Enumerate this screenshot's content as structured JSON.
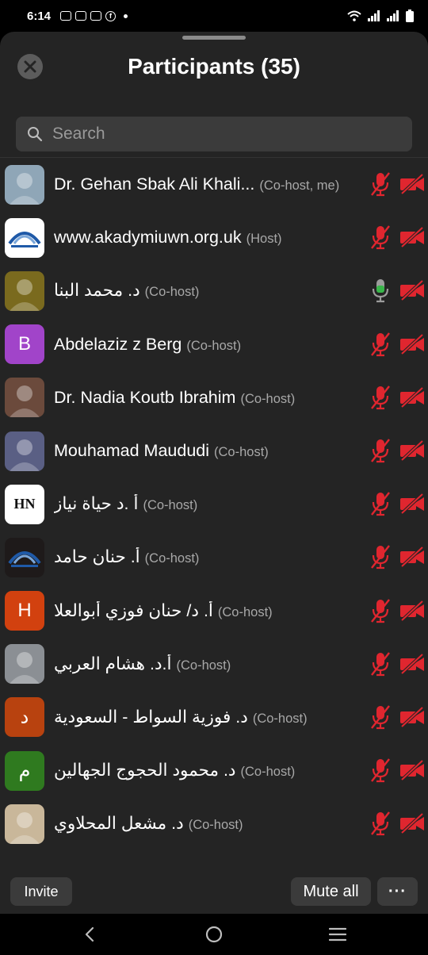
{
  "status_bar": {
    "time": "6:14",
    "notifications": [
      "notif-icon",
      "notif-icon",
      "notif-icon",
      "facebook-icon"
    ],
    "fb_glyph": "f"
  },
  "header": {
    "title": "Participants (35)"
  },
  "search": {
    "placeholder": "Search"
  },
  "colors": {
    "muted": "#e0262f",
    "live_mic": "#39b54a",
    "sheet_bg": "#242424"
  },
  "participants": [
    {
      "name": "Dr. Gehan Sbak Ali Khali...",
      "role": "(Co-host, me)",
      "avatar": {
        "type": "photo",
        "letter": "",
        "bg": "#8fa6b7"
      },
      "mic": "muted",
      "video": "off"
    },
    {
      "name": "www.akadymiuwn.org.uk",
      "role": "(Host)",
      "avatar": {
        "type": "logo",
        "letter": "",
        "bg": "#ffffff"
      },
      "mic": "muted",
      "video": "off"
    },
    {
      "name": "د. محمد البنا",
      "role": "(Co-host)",
      "avatar": {
        "type": "photo",
        "letter": "",
        "bg": "#7a6a1e"
      },
      "mic": "live",
      "video": "off"
    },
    {
      "name": "Abdelaziz z Berg",
      "role": "(Co-host)",
      "avatar": {
        "type": "letter",
        "letter": "B",
        "bg": "#a144c9"
      },
      "mic": "muted",
      "video": "off"
    },
    {
      "name": "Dr. Nadia Koutb Ibrahim",
      "role": "(Co-host)",
      "avatar": {
        "type": "photo",
        "letter": "",
        "bg": "#6b4a3c"
      },
      "mic": "muted",
      "video": "off"
    },
    {
      "name": "Mouhamad Maududi",
      "role": "(Co-host)",
      "avatar": {
        "type": "photo",
        "letter": "",
        "bg": "#5a5f84"
      },
      "mic": "muted",
      "video": "off"
    },
    {
      "name": "أ .د حياة نياز",
      "role": "(Co-host)",
      "avatar": {
        "type": "logo",
        "letter": "HN",
        "bg": "#ffffff"
      },
      "mic": "muted",
      "video": "off"
    },
    {
      "name": "أ. حنان حامد",
      "role": "(Co-host)",
      "avatar": {
        "type": "logo",
        "letter": "",
        "bg": "#1e1a1a"
      },
      "mic": "muted",
      "video": "off"
    },
    {
      "name": "أ. د/ حنان فوزي أبوالعلا",
      "role": "(Co-host)",
      "avatar": {
        "type": "letter",
        "letter": "H",
        "bg": "#d2410f"
      },
      "mic": "muted",
      "video": "off"
    },
    {
      "name": "أ.د. هشام العربي",
      "role": "(Co-host)",
      "avatar": {
        "type": "photo",
        "letter": "",
        "bg": "#8b8f94"
      },
      "mic": "muted",
      "video": "off"
    },
    {
      "name": "د. فوزية السواط - السعودية",
      "role": "(Co-host)",
      "avatar": {
        "type": "letter",
        "letter": "د",
        "bg": "#b8420f"
      },
      "mic": "muted",
      "video": "off"
    },
    {
      "name": "د. محمود الحجوج الجهالين",
      "role": "(Co-host)",
      "avatar": {
        "type": "letter",
        "letter": "م",
        "bg": "#2f7a1f"
      },
      "mic": "muted",
      "video": "off"
    },
    {
      "name": "د. مشعل المحلاوي",
      "role": "(Co-host)",
      "avatar": {
        "type": "photo",
        "letter": "",
        "bg": "#c9b79a"
      },
      "mic": "muted",
      "video": "off"
    }
  ],
  "footer": {
    "invite_label": "Invite",
    "mute_all_label": "Mute all",
    "more_label": "···"
  },
  "nav": {
    "back": "back-icon",
    "home": "home-icon",
    "recents": "recents-icon"
  }
}
